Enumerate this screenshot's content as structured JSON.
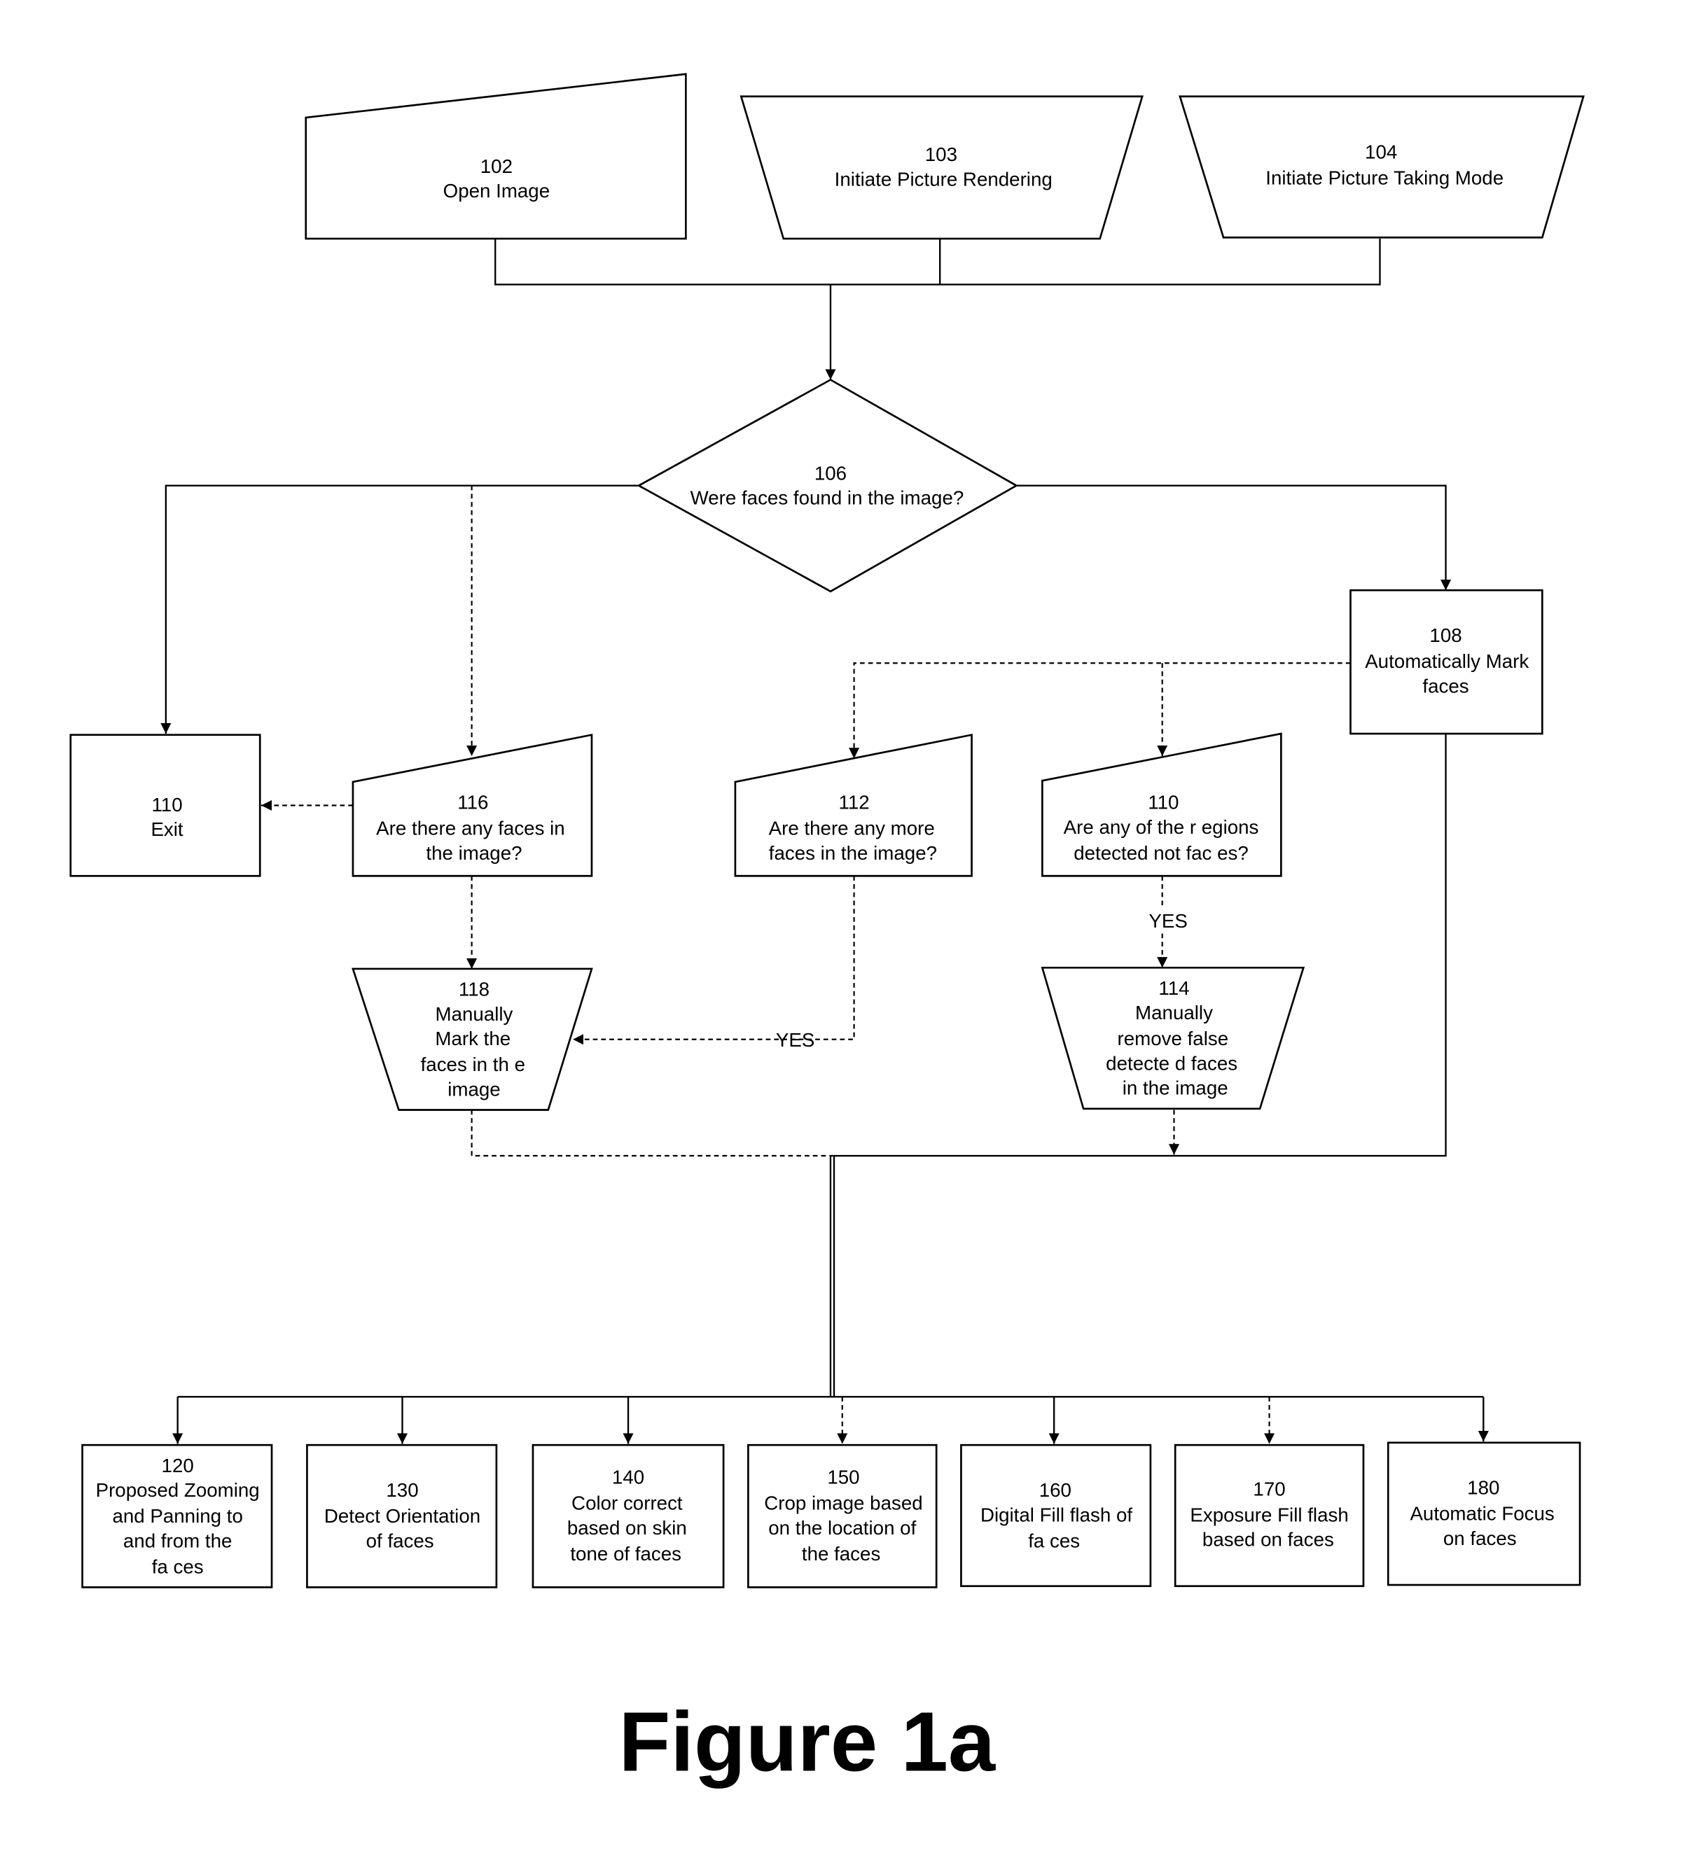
{
  "figure_title": "Figure 1a",
  "nodes": {
    "n102": {
      "id": "102",
      "lines": [
        "Open Image"
      ]
    },
    "n103": {
      "id": "103",
      "lines": [
        "Initiate Picture Rendering"
      ]
    },
    "n104": {
      "id": "104",
      "lines": [
        "Initiate Picture Taking Mode"
      ]
    },
    "n106": {
      "id": "106",
      "lines": [
        "Were faces found in the image?"
      ]
    },
    "n108": {
      "id": "108",
      "lines": [
        "Automatically Mark",
        "faces"
      ]
    },
    "n110a": {
      "id": "110",
      "lines": [
        "Exit"
      ]
    },
    "n116": {
      "id": "116",
      "lines": [
        "Are there any  faces in",
        "the image?"
      ]
    },
    "n112": {
      "id": "112",
      "lines": [
        "Are there any more",
        "faces in the image?"
      ]
    },
    "n110b": {
      "id": "110",
      "lines": [
        "Are any of the r egions",
        "detected not fac es?"
      ]
    },
    "n118": {
      "id": "118",
      "lines": [
        "Manually",
        "Mark the",
        "faces in th e",
        "image"
      ]
    },
    "n114": {
      "id": "114",
      "lines": [
        "Manually",
        "remove false",
        "detecte d faces",
        "in the image"
      ]
    },
    "n120": {
      "id": "120",
      "lines": [
        "Proposed Zooming",
        "and Panning to",
        "and from the",
        "fa ces"
      ]
    },
    "n130": {
      "id": "130",
      "lines": [
        "Detect Orientation",
        "of faces"
      ]
    },
    "n140": {
      "id": "140",
      "lines": [
        "Color correct",
        "based on skin",
        "tone of faces"
      ]
    },
    "n150": {
      "id": "150",
      "lines": [
        "Crop image based",
        "on the location of",
        "the faces"
      ]
    },
    "n160": {
      "id": "160",
      "lines": [
        "Digital Fill flash of",
        "fa ces"
      ]
    },
    "n170": {
      "id": "170",
      "lines": [
        "Exposure Fill flash",
        "based on   faces"
      ]
    },
    "n180": {
      "id": "180",
      "lines": [
        "Automatic Focus",
        "on faces"
      ]
    }
  },
  "edge_labels": {
    "yes_112_118": "YES",
    "yes_110_114": "YES"
  }
}
